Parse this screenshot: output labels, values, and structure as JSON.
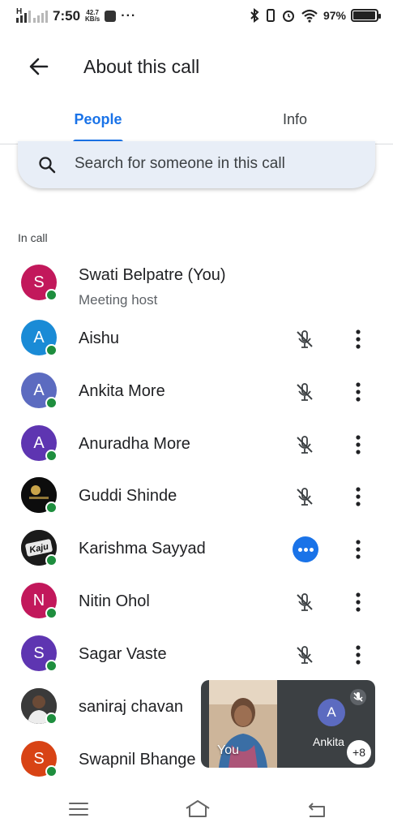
{
  "status_bar": {
    "network": "H",
    "time": "7:50",
    "speed_value": "42.7",
    "speed_unit": "KB/s",
    "more": "···",
    "battery_text": "97%",
    "battery_level": 0.97
  },
  "header": {
    "title": "About this call",
    "back_icon": "arrow-back-icon"
  },
  "tabs": {
    "people": "People",
    "info": "Info",
    "selected": "People",
    "accent": "#1a73e8"
  },
  "search": {
    "placeholder": "Search for someone in this call"
  },
  "section_label": "In call",
  "participants": [
    {
      "initial": "S",
      "name": "Swati Belpatre (You)",
      "subtitle": "Meeting host",
      "color": "#c2185b"
    },
    {
      "initial": "A",
      "name": "Aishu",
      "color": "#1a8bd6",
      "mic": "muted"
    },
    {
      "initial": "A",
      "name": "Ankita More",
      "color": "#5c6bc0",
      "mic": "muted"
    },
    {
      "initial": "A",
      "name": "Anuradha More",
      "color": "#5e35b1",
      "mic": "muted"
    },
    {
      "initial": "",
      "name": "Guddi Shinde",
      "color": "#111111",
      "mic": "muted"
    },
    {
      "initial": "",
      "name": "Karishma Sayyad",
      "color": "#111111",
      "mic": "speaking"
    },
    {
      "initial": "N",
      "name": "Nitin Ohol",
      "color": "#c2185b",
      "mic": "muted"
    },
    {
      "initial": "S",
      "name": "Sagar Vaste",
      "color": "#5e35b1",
      "mic": "muted"
    },
    {
      "initial": "",
      "name": "saniraj chavan",
      "color": "#222222"
    },
    {
      "initial": "S",
      "name": "Swapnil Bhange",
      "color": "#d84315"
    }
  ],
  "tile": {
    "self_label": "You",
    "other_initial": "A",
    "other_name": "Ankita",
    "more_count": "+8"
  },
  "nav": {
    "menu_icon": "menu-icon",
    "home_icon": "home-icon",
    "back_icon": "back-icon"
  }
}
